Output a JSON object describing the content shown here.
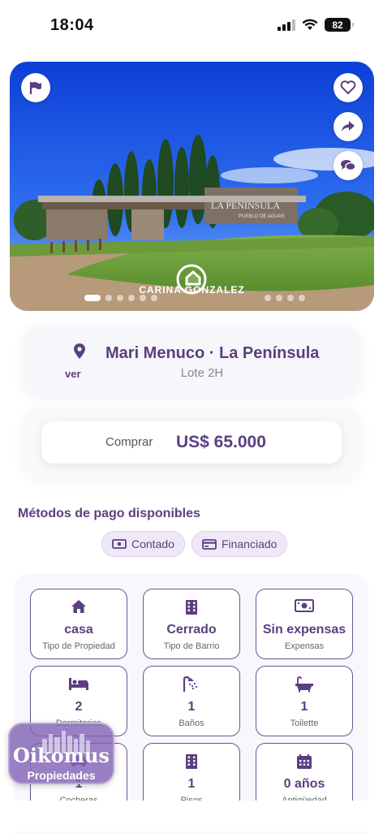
{
  "status_bar": {
    "time": "18:04",
    "battery": "82"
  },
  "hero": {
    "watermark": "CARINA GONZALEZ",
    "sign_text": "LA PENÍNSULA",
    "sign_subtext": "PUEBLO DE AGUAS",
    "slides_total": 12,
    "active_slide": 1,
    "buttons": [
      "flag-icon",
      "heart-icon",
      "share-icon",
      "chat-icon"
    ]
  },
  "location": {
    "title": "Mari Menuco · La Península",
    "subtitle": "Lote 2H",
    "ver_label": "ver"
  },
  "price": {
    "label": "Comprar",
    "value": "US$ 65.000"
  },
  "payment": {
    "title": "Métodos de pago disponibles",
    "methods": [
      {
        "label": "Contado",
        "icon": "cash-icon"
      },
      {
        "label": "Financiado",
        "icon": "card-icon"
      }
    ]
  },
  "features": [
    {
      "value": "casa",
      "label": "Tipo de Propiedad",
      "icon": "home-icon"
    },
    {
      "value": "Cerrado",
      "label": "Tipo de Barrio",
      "icon": "building-icon"
    },
    {
      "value": "Sin expensas",
      "label": "Expensas",
      "icon": "money-icon"
    },
    {
      "value": "2",
      "label": "Dormitorios",
      "icon": "bed-icon"
    },
    {
      "value": "1",
      "label": "Baños",
      "icon": "shower-icon"
    },
    {
      "value": "1",
      "label": "Toilette",
      "icon": "bathtub-icon"
    },
    {
      "value": "1",
      "label": "Cocheras",
      "icon": "car-icon"
    },
    {
      "value": "1",
      "label": "Pisos",
      "icon": "building-icon"
    },
    {
      "value": "0 años",
      "label": "Antigüedad",
      "icon": "calendar-icon"
    }
  ],
  "brand": {
    "name": "Oikomus",
    "subtitle": "Propiedades"
  },
  "colors": {
    "primary": "#5b3f7f",
    "chip_bg": "#efe9f7",
    "card_border": "#6b5590"
  }
}
